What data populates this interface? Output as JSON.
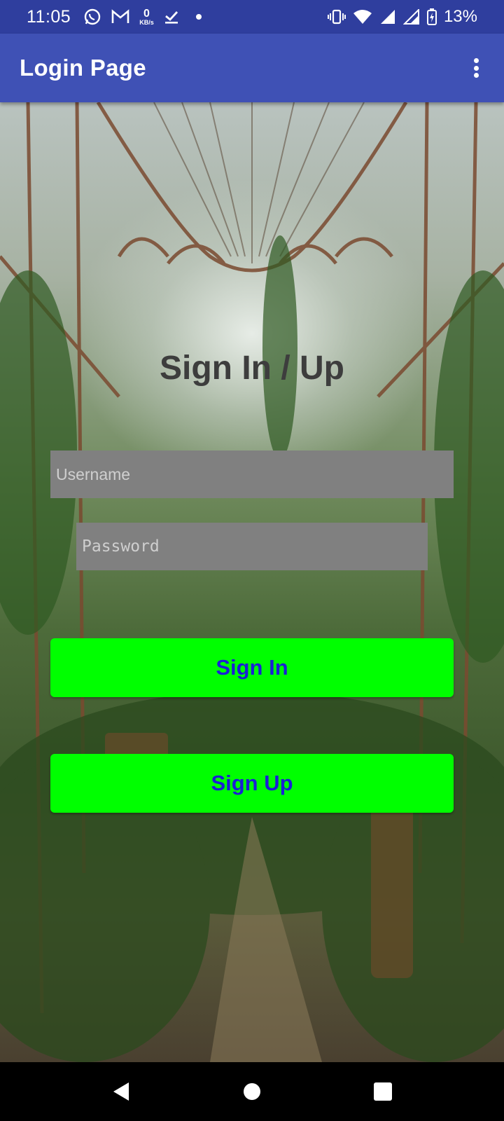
{
  "status_bar": {
    "time": "11:05",
    "net_speed_value": "0",
    "net_speed_unit": "KB/s",
    "battery_percent": "13%",
    "icons": [
      "whatsapp-icon",
      "gmail-icon",
      "net-speed-icon",
      "download-done-icon",
      "notification-dot-icon",
      "vibrate-icon",
      "wifi-icon",
      "cellular-signal-icon",
      "cellular-signal-2-icon",
      "battery-charging-icon"
    ]
  },
  "app_bar": {
    "title": "Login Page",
    "menu_icon": "more-vert-icon"
  },
  "form": {
    "heading": "Sign In / Up",
    "username_placeholder": "Username",
    "password_placeholder": "Password",
    "sign_in_label": "Sign In",
    "sign_up_label": "Sign Up"
  },
  "nav_bar": {
    "icons": [
      "back-icon",
      "home-icon",
      "recents-icon"
    ]
  },
  "colors": {
    "status_bar": "#2f3e9e",
    "app_bar": "#3f51b5",
    "button_bg": "#00ff00",
    "button_text": "#1a1fd6",
    "field_bg": "#808080",
    "heading": "#3d3d3d"
  }
}
